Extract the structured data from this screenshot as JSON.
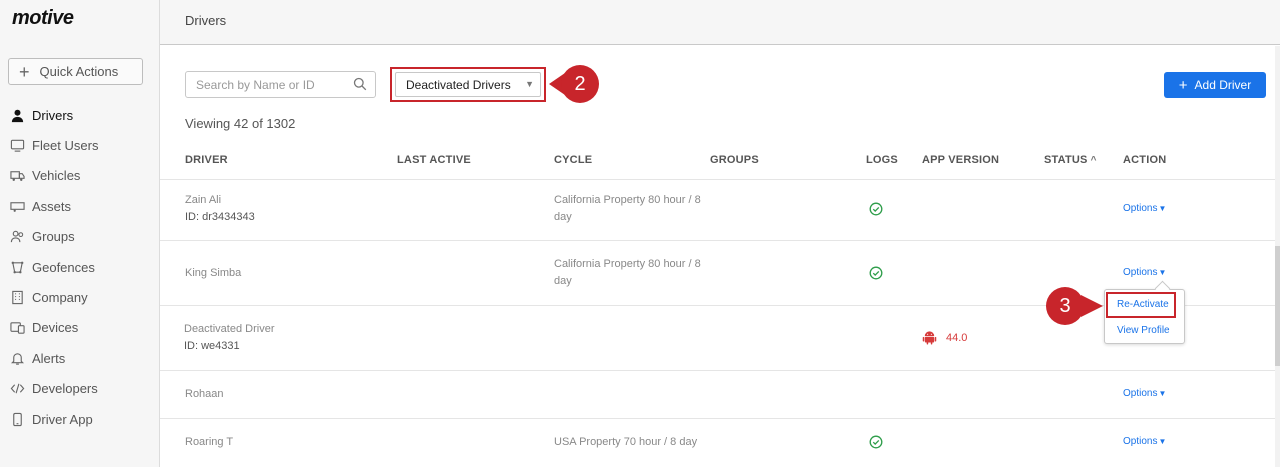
{
  "app": {
    "logo": "motive"
  },
  "sidebar": {
    "quick_actions_label": "Quick Actions",
    "items": [
      {
        "label": "Drivers",
        "icon": "person-icon",
        "active": true
      },
      {
        "label": "Fleet Users",
        "icon": "monitor-icon"
      },
      {
        "label": "Vehicles",
        "icon": "truck-icon"
      },
      {
        "label": "Assets",
        "icon": "trailer-icon"
      },
      {
        "label": "Groups",
        "icon": "groups-icon"
      },
      {
        "label": "Geofences",
        "icon": "geofence-icon"
      },
      {
        "label": "Company",
        "icon": "building-icon"
      },
      {
        "label": "Devices",
        "icon": "devices-icon"
      },
      {
        "label": "Alerts",
        "icon": "bell-icon"
      },
      {
        "label": "Developers",
        "icon": "code-icon"
      },
      {
        "label": "Driver App",
        "icon": "phone-icon"
      }
    ]
  },
  "header": {
    "title": "Drivers"
  },
  "toolbar": {
    "search_placeholder": "Search by Name or ID",
    "filter_selected": "Deactivated Drivers",
    "add_driver_label": "Add Driver",
    "callout_filter": "2",
    "callout_reactivate": "3"
  },
  "summary": {
    "viewing": "Viewing 42 of 1302"
  },
  "table": {
    "columns": {
      "driver": "DRIVER",
      "last_active": "LAST ACTIVE",
      "cycle": "CYCLE",
      "groups": "GROUPS",
      "logs": "LOGS",
      "app_version": "APP VERSION",
      "status": "STATUS",
      "action": "ACTION"
    },
    "rows": [
      {
        "name": "Zain Ali",
        "id": "ID: dr3434343",
        "cycle_1": "California Property 80 hour / 8",
        "cycle_2": "day",
        "logs_ok": true,
        "action": "Options"
      },
      {
        "name": "King Simba",
        "id": "",
        "cycle_1": "California Property 80 hour / 8",
        "cycle_2": "day",
        "logs_ok": true,
        "action": "Options"
      },
      {
        "name": "Deactivated Driver",
        "id": "ID: we4331",
        "cycle_1": "",
        "cycle_2": "",
        "logs_ok": false,
        "app_version": "44.0",
        "action": ""
      },
      {
        "name": "Rohaan",
        "id": "",
        "cycle_1": "",
        "cycle_2": "",
        "logs_ok": false,
        "action": "Options"
      },
      {
        "name": "Roaring T",
        "id": "",
        "cycle_1": "USA Property 70 hour / 8 day",
        "cycle_2": "",
        "logs_ok": true,
        "action": "Options"
      }
    ]
  },
  "dropdown": {
    "reactivate": "Re-Activate",
    "view_profile": "View Profile"
  },
  "colors": {
    "accent": "#1a73e8",
    "callout": "#c8252b",
    "ok": "#2e9d4a",
    "android": "#d63a3a"
  }
}
